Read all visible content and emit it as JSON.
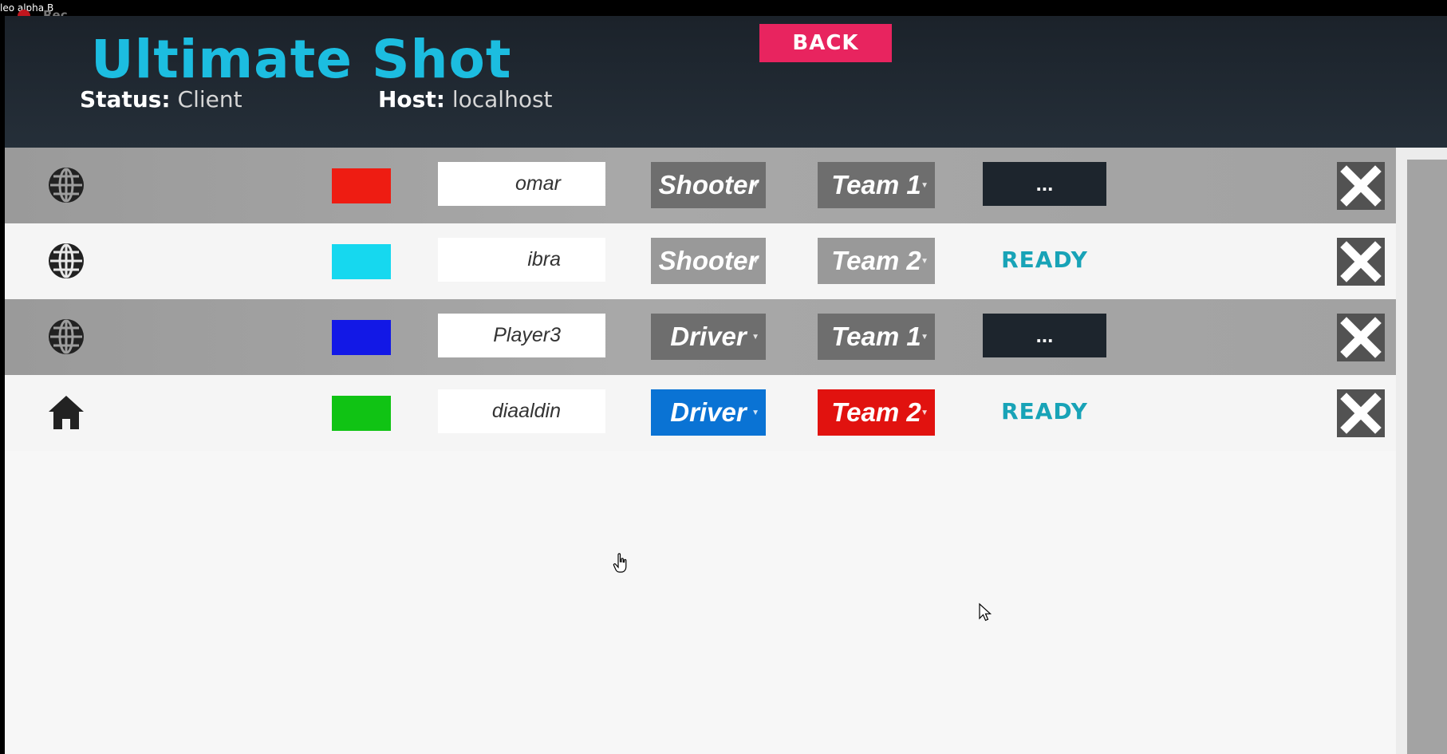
{
  "window": {
    "title": "leo alpha B",
    "rec_label": "Rec"
  },
  "header": {
    "title": "Ultimate Shot",
    "status_label": "Status:",
    "status_value": "Client",
    "host_label": "Host:",
    "host_value": "localhost",
    "back_label": "BACK",
    "title_color": "#1cbde0",
    "back_color": "#e8245f"
  },
  "players": [
    {
      "connection_icon": "globe-icon",
      "color": "#ee1c12",
      "name": "omar",
      "role": "Shooter",
      "team": "Team 1",
      "ready": "...",
      "is_ready": false
    },
    {
      "connection_icon": "globe-icon",
      "color": "#16d8ef",
      "name": "ibra",
      "role": "Shooter",
      "team": "Team 2",
      "ready": "READY",
      "is_ready": true
    },
    {
      "connection_icon": "globe-icon",
      "color": "#1218e6",
      "name": "Player3",
      "role": "Driver",
      "team": "Team 1",
      "ready": "...",
      "is_ready": false
    },
    {
      "connection_icon": "home-icon",
      "color": "#10c314",
      "name": "diaaldin",
      "role": "Driver",
      "team": "Team 2",
      "ready": "READY",
      "is_ready": true
    }
  ],
  "colors": {
    "role_active": "#0a73d4",
    "team_active": "#e1120f",
    "button_gray": "#6e6e6e",
    "button_gray_light": "#999999",
    "ready_text": "#18a3b7"
  }
}
